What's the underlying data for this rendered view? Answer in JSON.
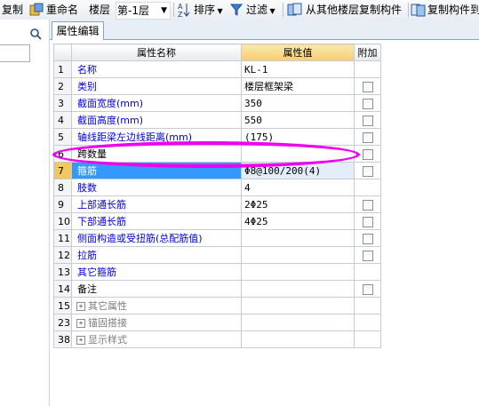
{
  "toolbar": {
    "copy_label": "复制",
    "rename_label": "重命名",
    "floor_label": "楼层",
    "floor_select_value": "第-1层",
    "sort_label": "排序",
    "filter_label": "过滤",
    "copy_from_floor_label": "从其他楼层复制构件",
    "copy_to_label": "复制构件到"
  },
  "tabs": {
    "active_label": "属性编辑"
  },
  "grid": {
    "col_name": "属性名称",
    "col_value": "属性值",
    "col_extra": "附加",
    "rows": [
      {
        "num": "1",
        "name": "名称",
        "value": "KL-1",
        "style": "blue",
        "check": false
      },
      {
        "num": "2",
        "name": "类别",
        "value": "楼层框架梁",
        "style": "blue",
        "check": true
      },
      {
        "num": "3",
        "name": "截面宽度(mm)",
        "value": "350",
        "style": "blue",
        "check": true
      },
      {
        "num": "4",
        "name": "截面高度(mm)",
        "value": "550",
        "style": "blue",
        "check": true
      },
      {
        "num": "5",
        "name": "轴线距梁左边线距离(mm)",
        "value": "(175)",
        "style": "blue",
        "check": true
      },
      {
        "num": "6",
        "name": "跨数量",
        "value": "",
        "style": "black",
        "check": true
      },
      {
        "num": "7",
        "name": "箍筋",
        "value": "Φ8@100/200(4)",
        "style": "blue",
        "check": true,
        "selected": true
      },
      {
        "num": "8",
        "name": "肢数",
        "value": "4",
        "style": "blue",
        "check": false
      },
      {
        "num": "9",
        "name": "上部通长筋",
        "value": "2Φ25",
        "style": "blue",
        "check": true
      },
      {
        "num": "10",
        "name": "下部通长筋",
        "value": "4Φ25",
        "style": "blue",
        "check": true
      },
      {
        "num": "11",
        "name": "侧面构造或受扭筋(总配筋值)",
        "value": "",
        "style": "blue",
        "check": true
      },
      {
        "num": "12",
        "name": "拉筋",
        "value": "",
        "style": "blue",
        "check": true
      },
      {
        "num": "13",
        "name": "其它箍筋",
        "value": "",
        "style": "blue",
        "check": false
      },
      {
        "num": "14",
        "name": "备注",
        "value": "",
        "style": "black",
        "check": true
      },
      {
        "num": "15",
        "name": "其它属性",
        "value": "",
        "style": "group",
        "check": false
      },
      {
        "num": "23",
        "name": "锚固搭接",
        "value": "",
        "style": "group",
        "check": false
      },
      {
        "num": "38",
        "name": "显示样式",
        "value": "",
        "style": "group",
        "check": false
      }
    ]
  },
  "annotation": {
    "color": "#ee00ee"
  }
}
